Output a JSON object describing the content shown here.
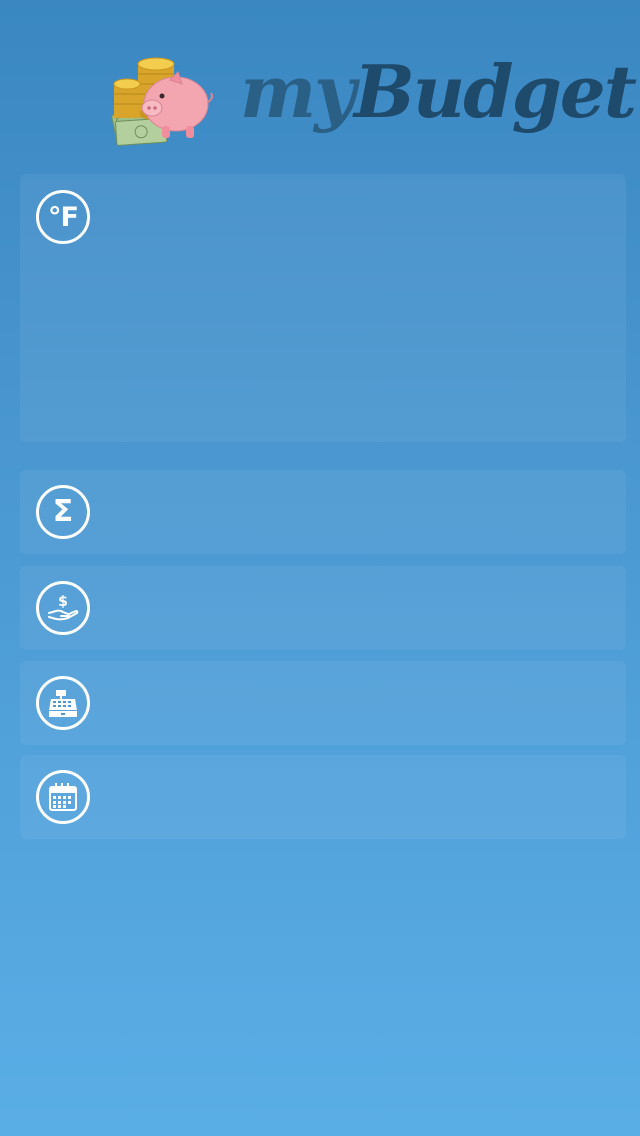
{
  "header": {
    "title_prefix": "my",
    "title_main": "Budget"
  },
  "weather": {
    "unit_symbol": "°F"
  },
  "total": {
    "symbol": "Σ"
  },
  "icons": {
    "weather": "fahrenheit-icon",
    "total": "sigma-sum-icon",
    "income": "hand-dollar-icon",
    "expenses": "cash-register-icon",
    "calendar": "calendar-icon",
    "logo": "piggy-bank-icon"
  },
  "colors": {
    "background_top": "#3a87c2",
    "background_bottom": "#5aaee6",
    "title_dark": "#1e4a6b",
    "icon_white": "#ffffff",
    "piggy_pink": "#f4a6b0",
    "coin_gold": "#e0b83a"
  }
}
